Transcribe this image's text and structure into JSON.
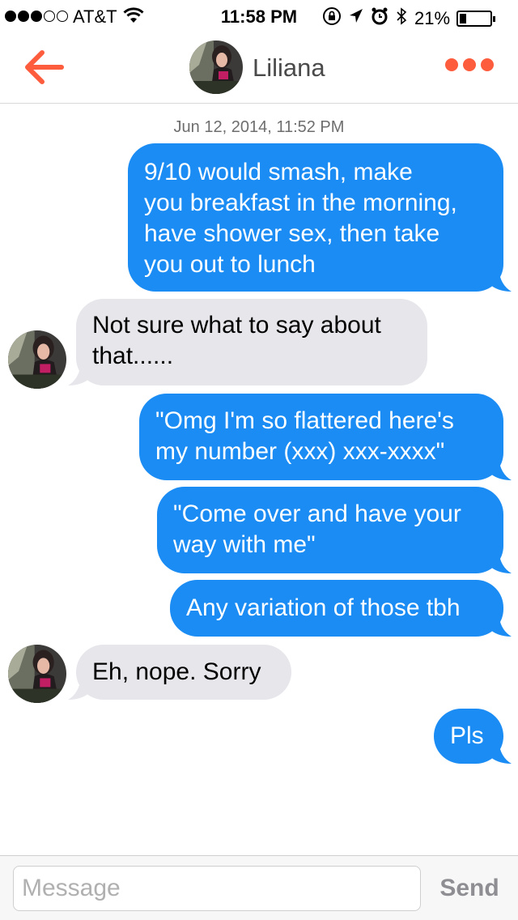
{
  "status_bar": {
    "carrier": "AT&T",
    "time": "11:58 PM",
    "battery_percent": "21%",
    "battery_level": 0.21,
    "signal_bars_filled": 3,
    "signal_bars_total": 5,
    "icons": [
      "wifi-icon",
      "orientation-lock-icon",
      "location-icon",
      "alarm-icon",
      "bluetooth-icon",
      "battery-icon"
    ]
  },
  "nav": {
    "contact_name": "Liliana",
    "accent_color": "#fd5c3d",
    "icons": [
      "back-arrow-icon",
      "more-options-icon"
    ]
  },
  "conversation": {
    "timestamp": "Jun 12, 2014, 11:52 PM",
    "messages": [
      {
        "direction": "outgoing",
        "lines": [
          "9/10 would smash, make",
          "you breakfast in the morning,",
          "have shower sex, then take",
          "you out to lunch"
        ]
      },
      {
        "direction": "incoming",
        "lines": [
          "Not sure what to say about",
          "that......"
        ]
      },
      {
        "direction": "outgoing",
        "lines": [
          "\"Omg I'm so flattered here's",
          "my number (xxx) xxx-xxxx\""
        ]
      },
      {
        "direction": "outgoing",
        "lines": [
          "\"Come over and have your",
          "way with me\""
        ]
      },
      {
        "direction": "outgoing",
        "lines": [
          "Any variation of those tbh"
        ]
      },
      {
        "direction": "incoming",
        "lines": [
          "Eh, nope. Sorry"
        ]
      },
      {
        "direction": "outgoing",
        "lines": [
          "Pls"
        ]
      }
    ],
    "colors": {
      "outgoing_bubble": "#1a8cf4",
      "incoming_bubble": "#e6e6eb"
    }
  },
  "composer": {
    "placeholder": "Message",
    "value": "",
    "send_label": "Send"
  }
}
